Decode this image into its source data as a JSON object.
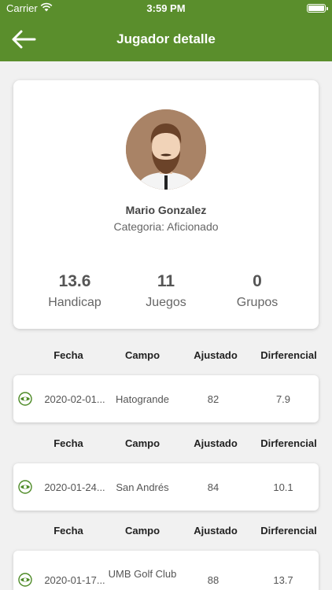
{
  "status": {
    "carrier": "Carrier",
    "time": "3:59 PM"
  },
  "header": {
    "title": "Jugador detalle"
  },
  "player": {
    "name": "Mario Gonzalez",
    "category": "Categoria: Aficionado",
    "stats": [
      {
        "value": "13.6",
        "label": "Handicap"
      },
      {
        "value": "11",
        "label": "Juegos"
      },
      {
        "value": "0",
        "label": "Grupos"
      }
    ]
  },
  "columns": {
    "fecha": "Fecha",
    "campo": "Campo",
    "ajustado": "Ajustado",
    "diferencial": "Dirferencial"
  },
  "rounds": [
    {
      "fecha": "2020-02-01...",
      "campo": "Hatogrande",
      "ajustado": "82",
      "diferencial": "7.9"
    },
    {
      "fecha": "2020-01-24...",
      "campo": "San Andrés",
      "ajustado": "84",
      "diferencial": "10.1"
    },
    {
      "fecha": "2020-01-17...",
      "campo": "UMB Golf Club",
      "ajustado": "88",
      "diferencial": "13.7"
    }
  ],
  "colors": {
    "brand": "#5a8e2c",
    "eye": "#4d8a26"
  }
}
